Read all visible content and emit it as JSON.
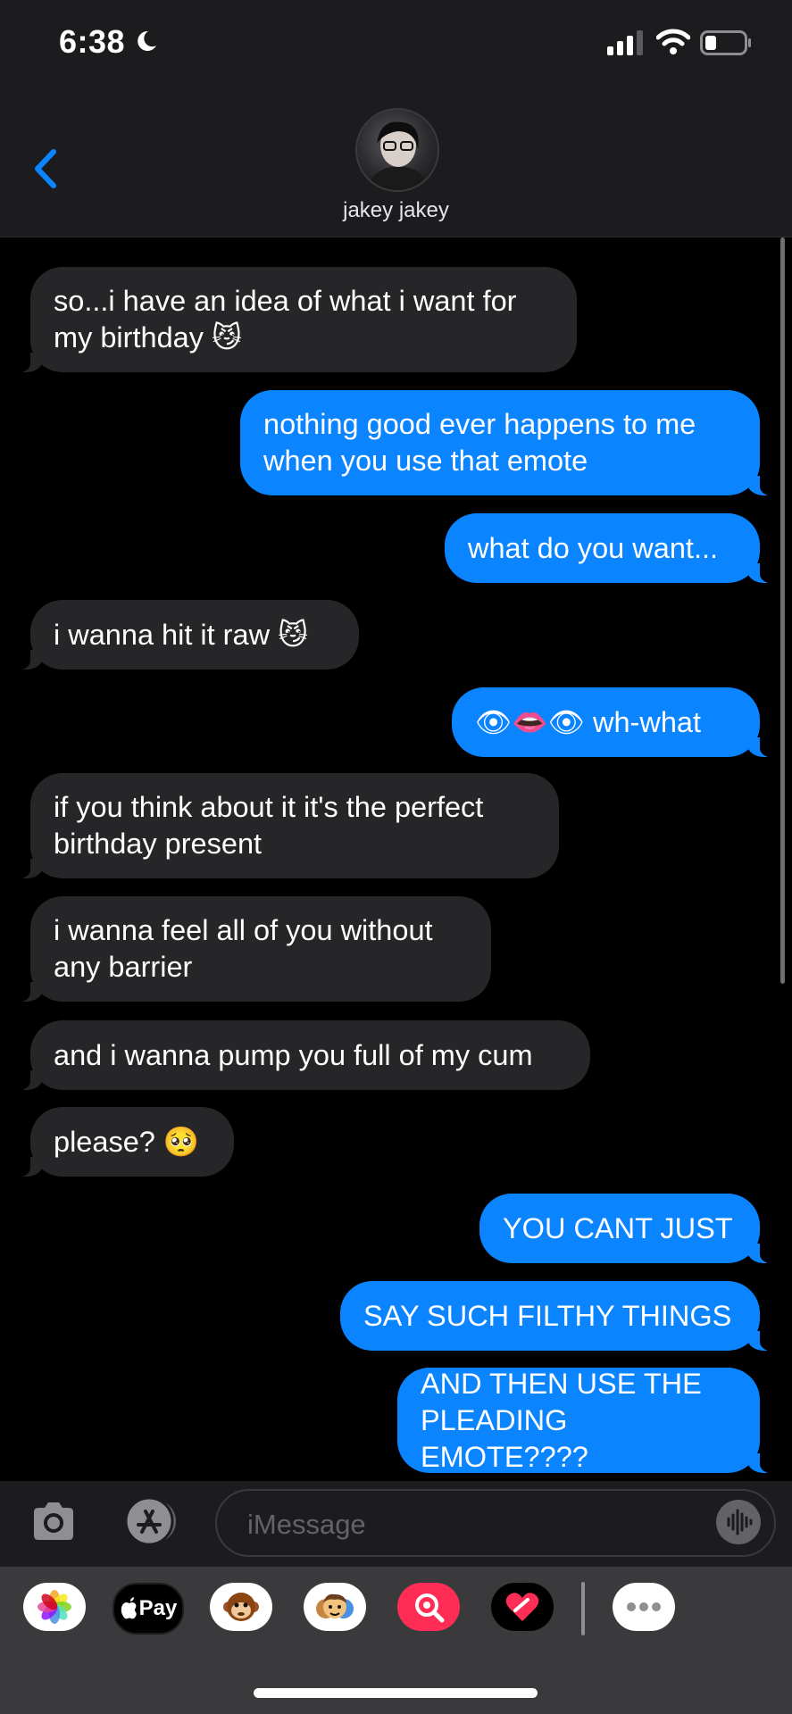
{
  "status_bar": {
    "time": "6:38"
  },
  "header": {
    "contact_name": "jakey jakey"
  },
  "messages": [
    {
      "text": "so...i have an idea of what i want for\nmy birthday 😼",
      "from": "them"
    },
    {
      "text": "nothing good ever happens to me\nwhen you use that emote",
      "from": "me"
    },
    {
      "text": "what do you want...",
      "from": "me"
    },
    {
      "text": "i wanna hit it raw 😼",
      "from": "them"
    },
    {
      "text": "👁👄👁 wh-what",
      "from": "me"
    },
    {
      "text": "if you think about it it's the perfect\nbirthday present",
      "from": "them"
    },
    {
      "text": "i wanna feel all of you without\nany barrier",
      "from": "them"
    },
    {
      "text": "and i wanna pump you full of my cum",
      "from": "them"
    },
    {
      "text": "please? 🥺",
      "from": "them"
    },
    {
      "text": "YOU CANT JUST",
      "from": "me"
    },
    {
      "text": "SAY SUCH FILTHY THINGS",
      "from": "me"
    },
    {
      "text": "AND THEN USE THE\nPLEADING EMOTE????",
      "from": "me"
    }
  ],
  "composer": {
    "placeholder": "iMessage"
  },
  "app_drawer": {
    "apple_pay_label": "Pay"
  },
  "colors": {
    "outgoing": "#0a84ff",
    "incoming": "#262628",
    "header": "#1c1c1e"
  },
  "icons": [
    "moon-icon",
    "signal-icon",
    "wifi-icon",
    "battery-icon",
    "back-chevron-icon",
    "camera-icon",
    "app-store-icon",
    "voice-memo-icon",
    "photos-icon",
    "apple-icon",
    "memoji-monkey-icon",
    "memoji-stickers-icon",
    "images-search-icon",
    "digital-touch-icon",
    "more-icon"
  ]
}
